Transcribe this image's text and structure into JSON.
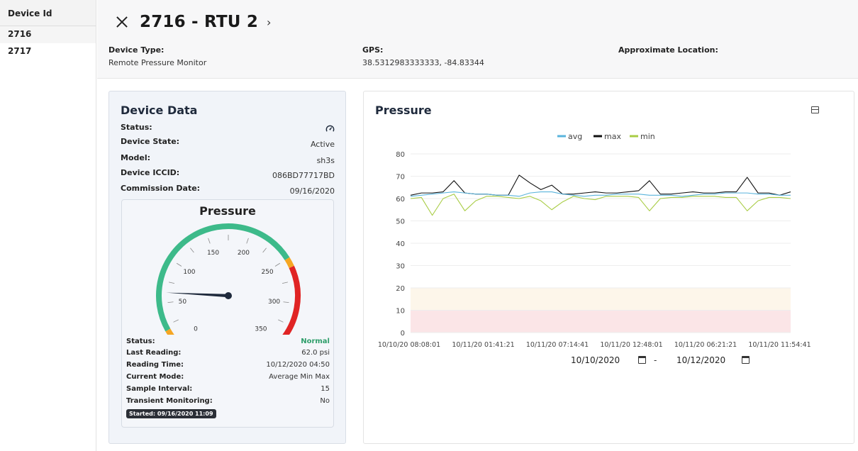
{
  "sidebar": {
    "header": "Device Id",
    "items": [
      "2716",
      "2717"
    ]
  },
  "header": {
    "title": "2716 - RTU 2",
    "device_type_label": "Device Type:",
    "device_type_value": "Remote Pressure Monitor",
    "gps_label": "GPS:",
    "gps_value": "38.5312983333333, -84.83344",
    "location_label": "Approximate Location:"
  },
  "device_data": {
    "title": "Device Data",
    "status_label": "Status:",
    "status_icon": "gauge-icon",
    "state_label": "Device State:",
    "state_value": "Active",
    "model_label": "Model:",
    "model_value": "sh3s",
    "iccid_label": "Device ICCID:",
    "iccid_value": "086BD77717BD",
    "commission_label": "Commission Date:",
    "commission_value": "09/16/2020"
  },
  "gauge": {
    "title": "Pressure",
    "value": 62,
    "min": 0,
    "max": 350,
    "ticks": [
      "0",
      "50",
      "100",
      "150",
      "200",
      "250",
      "300",
      "350"
    ],
    "bands": [
      {
        "from": 0,
        "to": 10,
        "color": "#e02424"
      },
      {
        "from": 10,
        "to": 20,
        "color": "#f5a623"
      },
      {
        "from": 20,
        "to": 250,
        "color": "#3dba8a"
      },
      {
        "from": 250,
        "to": 260,
        "color": "#f5a623"
      },
      {
        "from": 260,
        "to": 350,
        "color": "#e02424"
      }
    ],
    "status_label": "Status:",
    "status_value": "Normal",
    "last_reading_label": "Last Reading:",
    "last_reading_value": "62.0 psi",
    "reading_time_label": "Reading Time:",
    "reading_time_value": "10/12/2020 04:50",
    "mode_label": "Current Mode:",
    "mode_value": "Average Min Max",
    "interval_label": "Sample Interval:",
    "interval_value": "15",
    "transient_label": "Transient Monitoring:",
    "transient_value": "No",
    "started_badge": "Started: 09/16/2020 11:09"
  },
  "chart": {
    "title": "Pressure",
    "date_from": "10/10/2020",
    "date_to": "10/12/2020",
    "separator": "-"
  },
  "chart_data": {
    "type": "line",
    "ylim": [
      0,
      80
    ],
    "yticks": [
      0,
      10,
      20,
      30,
      40,
      50,
      60,
      70,
      80
    ],
    "xtick_labels": [
      "10/10/20 08:08:01",
      "10/11/20 01:41:21",
      "10/11/20 07:14:41",
      "10/11/20 12:48:01",
      "10/11/20 06:21:21",
      "10/11/20 11:54:41"
    ],
    "bands": [
      {
        "from": 0,
        "to": 10,
        "color": "#fbe5e7"
      },
      {
        "from": 10,
        "to": 20,
        "color": "#fdf6ea"
      }
    ],
    "legend": [
      "avg",
      "max",
      "min"
    ],
    "series": [
      {
        "name": "avg",
        "color": "#5ab4dc",
        "values": [
          61,
          61.5,
          62,
          62.5,
          63,
          62.5,
          62,
          62,
          61.5,
          61.5,
          61,
          62.5,
          63,
          63,
          62,
          61.5,
          61,
          61.5,
          61.5,
          62,
          62,
          62,
          61.5,
          61.5,
          61.5,
          61,
          61.5,
          62,
          62,
          62.5,
          62.5,
          62.5,
          62,
          62,
          61.5,
          61.5
        ]
      },
      {
        "name": "max",
        "color": "#111111",
        "values": [
          61.5,
          62.5,
          62.5,
          63,
          68,
          62.5,
          62,
          62,
          61.5,
          61.5,
          70.5,
          67,
          64,
          66,
          62,
          62,
          62.5,
          63,
          62.5,
          62.5,
          63,
          63.5,
          68,
          62,
          62,
          62.5,
          63,
          62.5,
          62.5,
          63,
          63,
          69.5,
          62.5,
          62.5,
          61.5,
          63
        ]
      },
      {
        "name": "min",
        "color": "#a8cc44",
        "values": [
          60,
          60.5,
          52.5,
          60,
          62,
          54.5,
          59,
          61,
          61,
          60.5,
          60,
          61,
          59,
          55,
          58.5,
          61,
          60,
          59.5,
          61,
          61,
          61,
          60.5,
          54.5,
          60,
          60.5,
          60.5,
          61,
          61,
          61,
          60.5,
          60.5,
          54.5,
          59,
          60.5,
          60.5,
          60
        ]
      }
    ]
  }
}
